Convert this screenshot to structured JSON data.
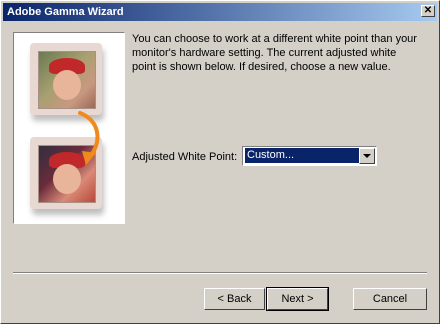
{
  "window": {
    "title": "Adobe Gamma Wizard",
    "close_glyph": "✕"
  },
  "content": {
    "description": "You can choose to work at a different white point than your monitor's hardware setting. The current adjusted white point is shown below. If desired, choose a new value.",
    "white_point_label": "Adjusted White Point:",
    "white_point_value": "Custom..."
  },
  "buttons": {
    "back": "< Back",
    "next": "Next >",
    "cancel": "Cancel"
  },
  "colors": {
    "accent": "#0a246a",
    "arrow": "#f08a1c"
  }
}
